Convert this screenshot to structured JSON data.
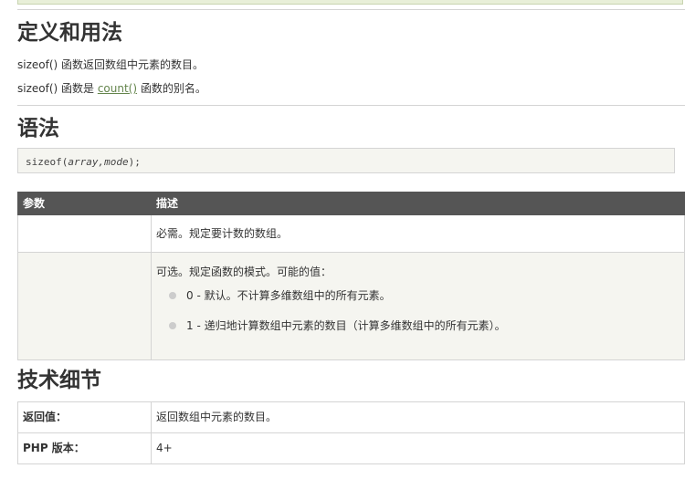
{
  "section_definition": {
    "heading": "定义和用法",
    "line1": "sizeof() 函数返回数组中元素的数目。",
    "line2_before": "sizeof() 函数是 ",
    "line2_link": "count()",
    "line2_after": " 函数的别名。"
  },
  "section_syntax": {
    "heading": "语法",
    "code_func": "sizeof(",
    "code_args": "array,mode",
    "code_end": ");"
  },
  "param_table": {
    "headers": [
      "参数",
      "描述"
    ],
    "row1": {
      "param": "",
      "desc": "必需。规定要计数的数组。"
    },
    "row2": {
      "param": "",
      "desc_intro": "可选。规定函数的模式。可能的值：",
      "options": [
        "0 - 默认。不计算多维数组中的所有元素。",
        "1 - 递归地计算数组中元素的数目（计算多维数组中的所有元素）。"
      ]
    }
  },
  "section_tech": {
    "heading": "技术细节",
    "rows": [
      {
        "label": "返回值：",
        "value": "返回数组中元素的数目。"
      },
      {
        "label": "PHP 版本：",
        "value": "4+"
      }
    ]
  }
}
